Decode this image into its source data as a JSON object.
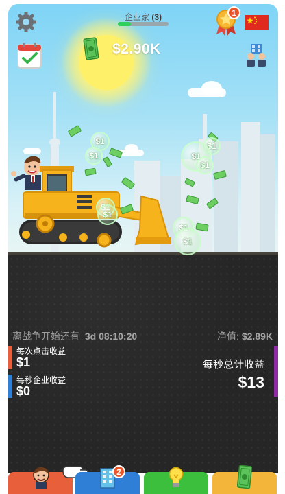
{
  "header": {
    "level_title": "企业家",
    "level_number": "(3)",
    "xp_progress": 0.25,
    "money": "$2.90K",
    "notification_count": "1"
  },
  "icons": {
    "settings": "gear-icon",
    "achievements": "star-medal-icon",
    "language": "china-flag-icon",
    "daily_tasks": "calendar-check-icon",
    "managers": "managers-icon",
    "cash": "cash-icon"
  },
  "scene": {
    "bubbles": [
      "$1",
      "$1",
      "$1",
      "$1",
      "$1",
      "$1",
      "$1",
      "$1",
      "$1"
    ]
  },
  "stats": {
    "war_label": "离战争开始还有",
    "war_timer": "3d 08:10:20",
    "net_worth_label": "净值:",
    "net_worth_value": "$2.89K",
    "per_click_label": "每次点击收益",
    "per_click_value": "$1",
    "per_business_label": "每秒企业收益",
    "per_business_value": "$0",
    "total_label": "每秒总计收益",
    "total_value": "$13"
  },
  "tabs": {
    "businesses_badge": "2"
  },
  "colors": {
    "money_green": "#2fd05b",
    "tab_orange": "#e85f3c",
    "tab_blue": "#2f7fd6",
    "tab_green": "#3cbf3c",
    "tab_yellow": "#f3b53a",
    "side_purple": "#8e2aa6"
  }
}
